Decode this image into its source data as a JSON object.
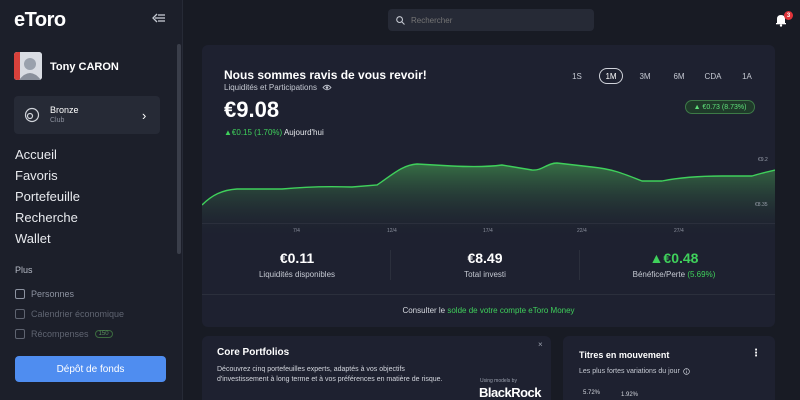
{
  "sidebar": {
    "logo": "eToro",
    "user_name": "Tony CARON",
    "club": {
      "name": "Bronze",
      "sub": "Club"
    },
    "nav": [
      "Accueil",
      "Favoris",
      "Portefeuille",
      "Recherche",
      "Wallet"
    ],
    "more_label": "Plus",
    "sub_items": [
      "Personnes",
      "Calendrier économique",
      "Récompenses"
    ],
    "rewards_badge": "150",
    "deposit_label": "Dépôt de fonds"
  },
  "topbar": {
    "search_placeholder": "Rechercher",
    "notification_count": "3"
  },
  "portfolio": {
    "welcome": "Nous sommes ravis de vous revoir!",
    "liquidity_label": "Liquidités et Participations",
    "total_value": "€9.08",
    "change_prefix": "▲€0.15 (1.70%)",
    "change_suffix": " Aujourd'hui",
    "timeframes": [
      "1S",
      "1M",
      "3M",
      "6M",
      "CDA",
      "1A"
    ],
    "active_timeframe": "1M",
    "period_change": "▲ €0.73 (8.73%)",
    "chart_high": "€9.2",
    "chart_low": "€8.35",
    "x_ticks": [
      "7/4",
      "12/4",
      "17/4",
      "22/4",
      "27/4"
    ],
    "stats": [
      {
        "value": "€0.11",
        "label": "Liquidités disponibles"
      },
      {
        "value": "€8.49",
        "label": "Total investi"
      },
      {
        "value": "▲€0.48",
        "label": "Bénéfice/Perte",
        "extra": "(5.69%)"
      }
    ],
    "footer_prefix": "Consulter le ",
    "footer_link": "solde de votre compte eToro Money"
  },
  "core_portfolios": {
    "title": "Core Portfolios",
    "description": "Découvrez cinq portefeuilles experts, adaptés à vos objectifs d'investissement à long terme et à vos préférences en matière de risque.",
    "partner_small": "Using models by",
    "partner": "BlackRock",
    "close": "×"
  },
  "movers": {
    "title": "Titres en mouvement",
    "subtitle": "Les plus fortes variations du jour",
    "value_1": "5.72%",
    "value_2": "1.92%"
  },
  "colors": {
    "accent_green": "#3fd05b",
    "deposit_blue": "#4f8df0",
    "background": "#181b24"
  }
}
